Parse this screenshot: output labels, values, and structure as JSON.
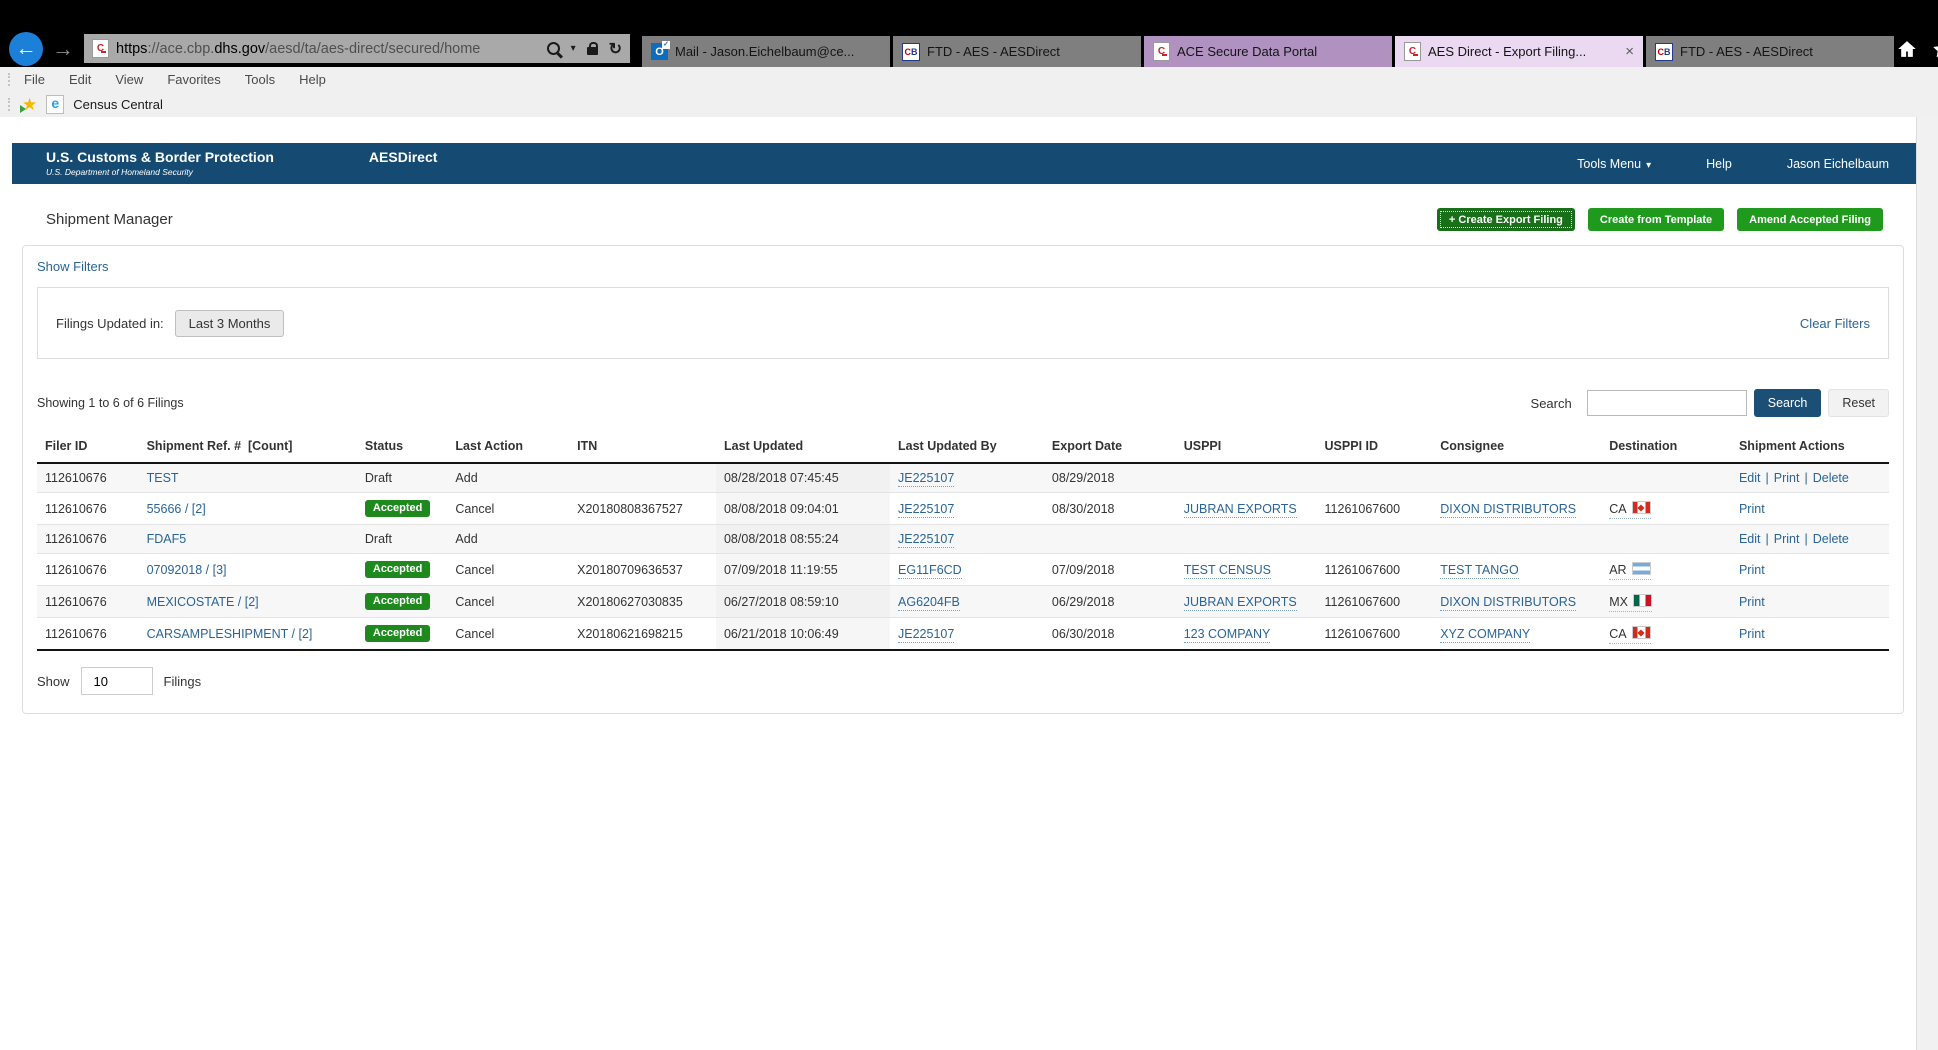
{
  "colors": {
    "header_navy": "#154a72",
    "green_button": "#1f9a1d",
    "green_button_dark": "#176f17",
    "badge_green": "#1e8a1e",
    "link_blue": "#2a6496",
    "search_button_navy": "#1c4f76"
  },
  "icons": {
    "back": "←",
    "forward": "→",
    "caret_down": "▾",
    "refresh": "↻",
    "close": "×",
    "star": "★",
    "check": "✓"
  },
  "browser": {
    "url_parts": [
      {
        "text": "https",
        "em": true
      },
      {
        "text": "://ace.cbp.",
        "em": false
      },
      {
        "text": "dhs.gov",
        "em": true
      },
      {
        "text": "/aesd/ta/aes-direct/secured/home",
        "em": false
      }
    ],
    "tabs": [
      {
        "label": "Mail - Jason.Eichelbaum@ce...",
        "icon": "outlook",
        "accent": "grey",
        "closable": false
      },
      {
        "label": "FTD - AES - AESDirect",
        "icon": "cb",
        "accent": "grey",
        "closable": false
      },
      {
        "label": "ACE Secure Data Portal",
        "icon": "ace",
        "accent": "purple",
        "closable": false
      },
      {
        "label": "AES Direct - Export Filing...",
        "icon": "ace",
        "accent": "active",
        "closable": true
      },
      {
        "label": "FTD - AES - AESDirect",
        "icon": "cb",
        "accent": "grey",
        "closable": false
      }
    ],
    "menu_items": [
      "File",
      "Edit",
      "View",
      "Favorites",
      "Tools",
      "Help"
    ],
    "favorites_link": "Census Central"
  },
  "header": {
    "org_name": "U.S. Customs & Border Protection",
    "org_tagline": "U.S. Department of Homeland Security",
    "app_name": "AESDirect",
    "nav": [
      {
        "label": "Tools Menu",
        "caret": true
      },
      {
        "label": "Help",
        "caret": false
      },
      {
        "label": "Jason Eichelbaum",
        "caret": false
      }
    ]
  },
  "page": {
    "title": "Shipment Manager",
    "action_buttons": [
      {
        "label": "+ Create Export Filing",
        "variant": "dark"
      },
      {
        "label": "Create from Template",
        "variant": "bright"
      },
      {
        "label": "Amend Accepted Filing",
        "variant": "bright"
      }
    ],
    "show_filters_link": "Show Filters",
    "filter": {
      "label": "Filings Updated in:",
      "chip": "Last 3 Months",
      "clear_link": "Clear Filters"
    },
    "summary": "Showing 1 to 6 of 6 Filings",
    "search": {
      "label": "Search",
      "value": "",
      "button": "Search",
      "reset": "Reset"
    },
    "pagination": {
      "show_label": "Show",
      "value": "10",
      "filings_label": "Filings"
    }
  },
  "table": {
    "columns": [
      "Filer ID",
      "Shipment Ref. #  [Count]",
      "Status",
      "Last Action",
      "ITN",
      "Last Updated",
      "Last Updated By",
      "Export Date",
      "USPPI",
      "USPPI ID",
      "Consignee",
      "Destination",
      "Shipment Actions"
    ],
    "rows": [
      {
        "filer_id": "112610676",
        "ref": "TEST",
        "status": "Draft",
        "status_badge": false,
        "last_action": "Add",
        "itn": "",
        "last_updated": "08/28/2018 07:45:45",
        "last_updated_by": "JE225107",
        "export_date": "08/29/2018",
        "usppi": "",
        "usppi_id": "",
        "consignee": "",
        "dest_code": "",
        "dest_flag": "",
        "actions": [
          "Edit",
          "Print",
          "Delete"
        ]
      },
      {
        "filer_id": "112610676",
        "ref": "55666 / [2]",
        "status": "Accepted",
        "status_badge": true,
        "last_action": "Cancel",
        "itn": "X20180808367527",
        "last_updated": "08/08/2018 09:04:01",
        "last_updated_by": "JE225107",
        "export_date": "08/30/2018",
        "usppi": "JUBRAN EXPORTS",
        "usppi_id": "11261067600",
        "consignee": "DIXON DISTRIBUTORS",
        "dest_code": "CA",
        "dest_flag": "ca",
        "actions": [
          "Print"
        ]
      },
      {
        "filer_id": "112610676",
        "ref": "FDAF5",
        "status": "Draft",
        "status_badge": false,
        "last_action": "Add",
        "itn": "",
        "last_updated": "08/08/2018 08:55:24",
        "last_updated_by": "JE225107",
        "export_date": "",
        "usppi": "",
        "usppi_id": "",
        "consignee": "",
        "dest_code": "",
        "dest_flag": "",
        "actions": [
          "Edit",
          "Print",
          "Delete"
        ]
      },
      {
        "filer_id": "112610676",
        "ref": "07092018 / [3]",
        "status": "Accepted",
        "status_badge": true,
        "last_action": "Cancel",
        "itn": "X20180709636537",
        "last_updated": "07/09/2018 11:19:55",
        "last_updated_by": "EG11F6CD",
        "export_date": "07/09/2018",
        "usppi": "TEST CENSUS",
        "usppi_id": "11261067600",
        "consignee": "TEST TANGO",
        "dest_code": "AR",
        "dest_flag": "ar",
        "actions": [
          "Print"
        ]
      },
      {
        "filer_id": "112610676",
        "ref": "MEXICOSTATE / [2]",
        "status": "Accepted",
        "status_badge": true,
        "last_action": "Cancel",
        "itn": "X20180627030835",
        "last_updated": "06/27/2018 08:59:10",
        "last_updated_by": "AG6204FB",
        "export_date": "06/29/2018",
        "usppi": "JUBRAN EXPORTS",
        "usppi_id": "11261067600",
        "consignee": "DIXON DISTRIBUTORS",
        "dest_code": "MX",
        "dest_flag": "mx",
        "actions": [
          "Print"
        ]
      },
      {
        "filer_id": "112610676",
        "ref": "CARSAMPLESHIPMENT / [2]",
        "status": "Accepted",
        "status_badge": true,
        "last_action": "Cancel",
        "itn": "X20180621698215",
        "last_updated": "06/21/2018 10:06:49",
        "last_updated_by": "JE225107",
        "export_date": "06/30/2018",
        "usppi": "123 COMPANY",
        "usppi_id": "11261067600",
        "consignee": "XYZ COMPANY",
        "dest_code": "CA",
        "dest_flag": "ca",
        "actions": [
          "Print"
        ]
      }
    ]
  }
}
